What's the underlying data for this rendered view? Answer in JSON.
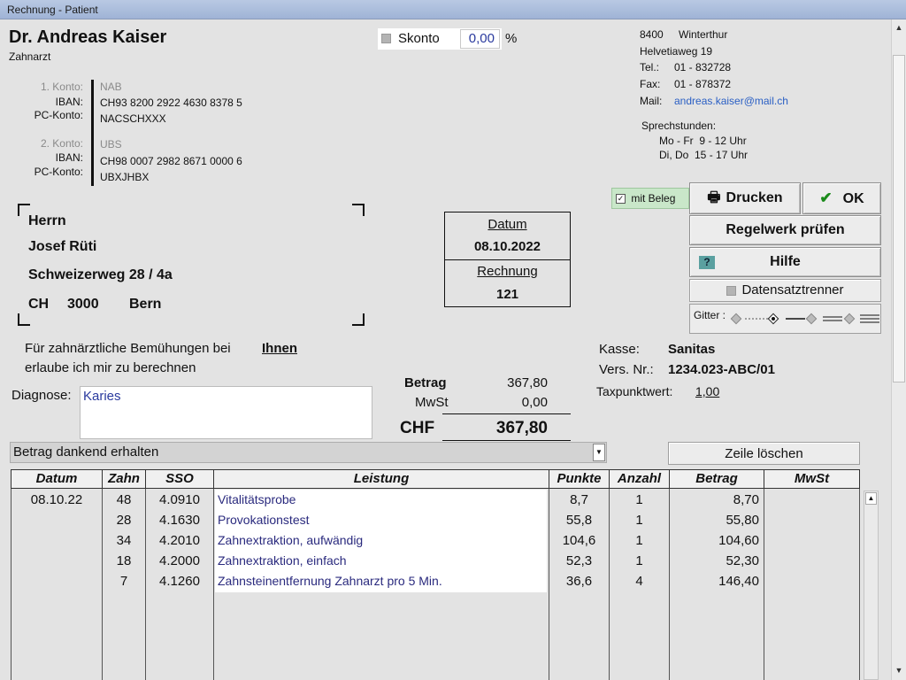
{
  "window": {
    "title": "Rechnung - Patient"
  },
  "doctor": {
    "name": "Dr. Andreas Kaiser",
    "title": "Zahnarzt"
  },
  "accounts": [
    {
      "konto_label": "1. Konto:",
      "bank": "NAB",
      "iban_label": "IBAN:",
      "iban": "CH93 8200 2922 4630 8378 5",
      "pc_label": "PC-Konto:",
      "pc": "NACSCHXXX"
    },
    {
      "konto_label": "2. Konto:",
      "bank": "UBS",
      "iban_label": "IBAN:",
      "iban": "CH98 0007 2982 8671 0000 6",
      "pc_label": "PC-Konto:",
      "pc": "UBXJHBX"
    }
  ],
  "skonto": {
    "label": "Skonto",
    "value": "0,00",
    "unit": "%"
  },
  "address": {
    "zip": "8400",
    "city": "Winterthur",
    "street": "Helvetiaweg 19",
    "tel_label": "Tel.:",
    "tel": "01 - 832728",
    "fax_label": "Fax:",
    "fax": "01 - 878372",
    "mail_label": "Mail:",
    "mail": "andreas.kaiser@mail.ch",
    "hours_label": "Sprechstunden:",
    "hours_1": "Mo - Fr  9 - 12 Uhr",
    "hours_2": "Di, Do  15 - 17 Uhr"
  },
  "buttons": {
    "mit_beleg": "mit Beleg",
    "drucken": "Drucken",
    "ok": "OK",
    "regelwerk": "Regelwerk prüfen",
    "hilfe": "Hilfe",
    "datensatz": "Datensatztrenner",
    "gitter": "Gitter :",
    "zeile_loeschen": "Zeile löschen"
  },
  "recipient": {
    "salutation": "Herrn",
    "name": "Josef Rüti",
    "street": "Schweizerweg 28 / 4a",
    "country": "CH",
    "zip": "3000",
    "city": "Bern"
  },
  "invoice": {
    "date_label": "Datum",
    "date": "08.10.2022",
    "number_label": "Rechnung",
    "number": "121"
  },
  "intro": {
    "line1": "Für zahnärztliche Bemühungen bei",
    "line2": "erlaube ich mir zu berechnen",
    "addressee": "Ihnen"
  },
  "insurance": {
    "kasse_label": "Kasse:",
    "kasse": "Sanitas",
    "vers_label": "Vers. Nr.:",
    "vers": "1234.023-ABC/01",
    "tpw_label": "Taxpunktwert:",
    "tpw": "1,00"
  },
  "diagnosis": {
    "label": "Diagnose:",
    "value": "Karies"
  },
  "totals": {
    "betrag_label": "Betrag",
    "betrag": "367,80",
    "mwst_label": "MwSt",
    "mwst": "0,00",
    "currency": "CHF",
    "total": "367,80"
  },
  "status_combo": {
    "value": "Betrag dankend erhalten"
  },
  "table": {
    "headers": [
      "Datum",
      "Zahn",
      "SSO",
      "Leistung",
      "Punkte",
      "Anzahl",
      "Betrag",
      "MwSt"
    ],
    "rows": [
      {
        "datum": "08.10.22",
        "zahn": "48",
        "sso": "4.0910",
        "leistung": "Vitalitätsprobe",
        "punkte": "8,7",
        "anzahl": "1",
        "betrag": "8,70",
        "mwst": ""
      },
      {
        "datum": "",
        "zahn": "28",
        "sso": "4.1630",
        "leistung": "Provokationstest",
        "punkte": "55,8",
        "anzahl": "1",
        "betrag": "55,80",
        "mwst": ""
      },
      {
        "datum": "",
        "zahn": "34",
        "sso": "4.2010",
        "leistung": "Zahnextraktion, aufwändig",
        "punkte": "104,6",
        "anzahl": "1",
        "betrag": "104,60",
        "mwst": ""
      },
      {
        "datum": "",
        "zahn": "18",
        "sso": "4.2000",
        "leistung": "Zahnextraktion, einfach",
        "punkte": "52,3",
        "anzahl": "1",
        "betrag": "52,30",
        "mwst": ""
      },
      {
        "datum": "",
        "zahn": "7",
        "sso": "4.1260",
        "leistung": "Zahnsteinentfernung Zahnarzt pro 5 Min.",
        "punkte": "36,6",
        "anzahl": "4",
        "betrag": "146,40",
        "mwst": ""
      }
    ]
  }
}
